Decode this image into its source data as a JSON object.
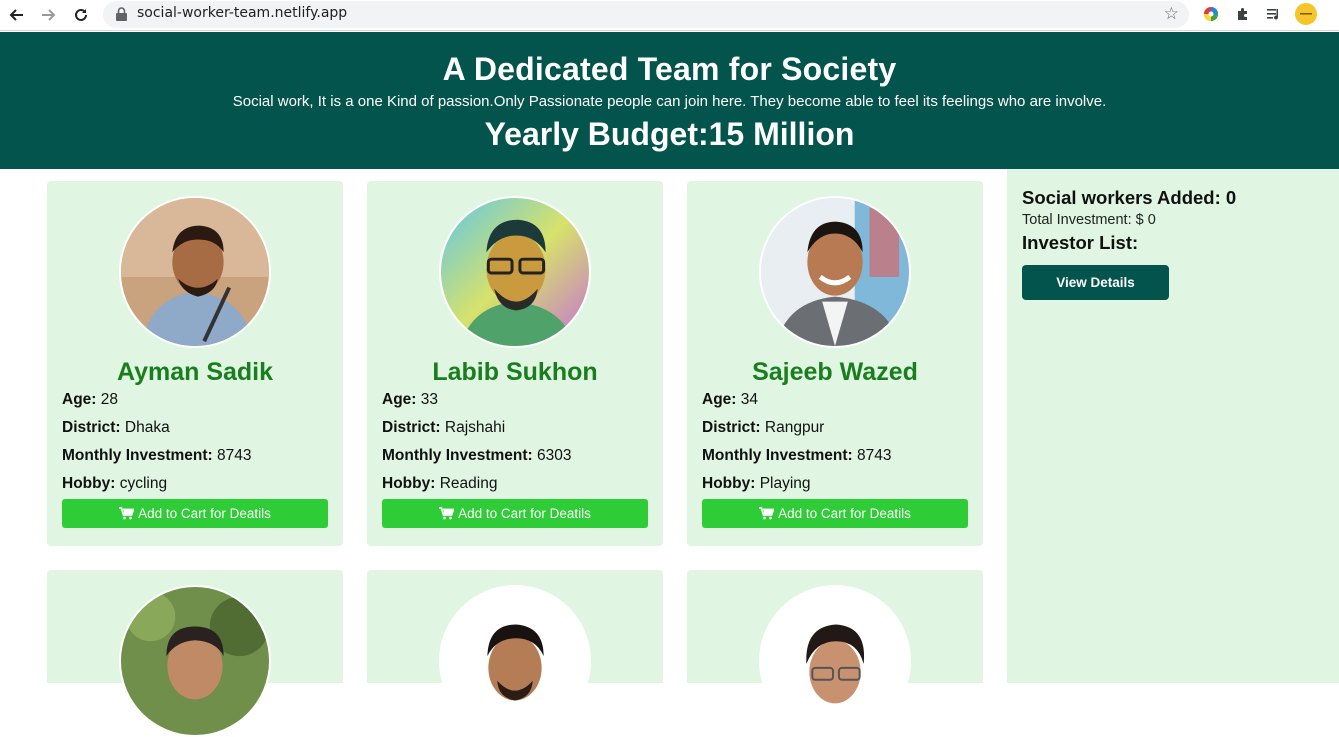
{
  "browser": {
    "url": "social-worker-team.netlify.app",
    "back_icon": "back-arrow-icon",
    "forward_icon": "forward-arrow-icon",
    "reload_icon": "reload-icon"
  },
  "header": {
    "title": "A Dedicated Team for Society",
    "description": "Social work, It is a one Kind of passion.Only Passionate people can join here. They become able to feel its feelings who are involve.",
    "budget": "Yearly Budget:15 Million"
  },
  "labels": {
    "age": "Age:",
    "district": "District:",
    "investment": "Monthly Investment:",
    "hobby": "Hobby:",
    "cart_button": "Add to Cart for Deatils"
  },
  "workers": [
    {
      "name": "Ayman Sadik",
      "age": "28",
      "district": "Dhaka",
      "investment": "8743",
      "hobby": "cycling"
    },
    {
      "name": "Labib Sukhon",
      "age": "33",
      "district": "Rajshahi",
      "investment": "6303",
      "hobby": "Reading"
    },
    {
      "name": "Sajeeb Wazed",
      "age": "34",
      "district": "Rangpur",
      "investment": "8743",
      "hobby": "Playing"
    }
  ],
  "sidebar": {
    "added_label": "Social workers Added: 0",
    "total_investment": "Total Investment: $ 0",
    "investor_list": "Investor List:",
    "view_button": "View Details"
  },
  "colors": {
    "header_bg": "#03544c",
    "card_bg": "#e1f5e3",
    "name_color": "#197e1d",
    "cart_button_bg": "#2ecd37"
  }
}
